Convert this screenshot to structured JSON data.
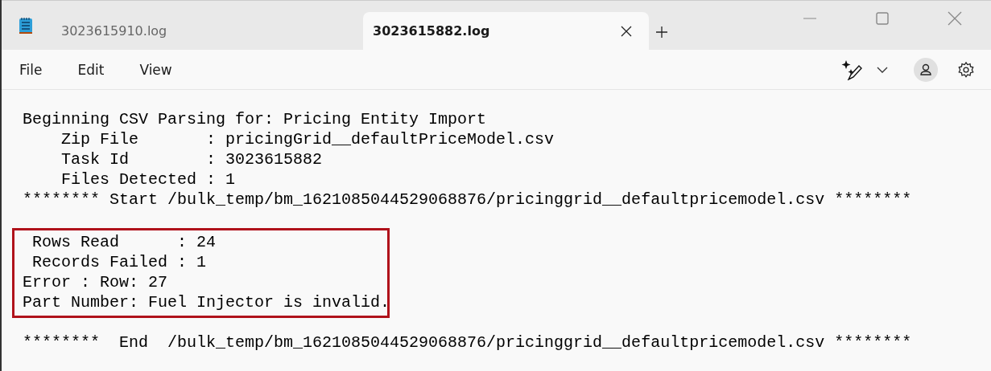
{
  "tabs": [
    {
      "label": "3023615910.log",
      "selected": false
    },
    {
      "label": "3023615882.log",
      "selected": true
    }
  ],
  "menu": [
    "File",
    "Edit",
    "View"
  ],
  "document": {
    "lines_before": [
      "Beginning CSV Parsing for: Pricing Entity Import",
      "    Zip File       : pricingGrid__defaultPriceModel.csv",
      "    Task Id        : 3023615882",
      "    Files Detected : 1",
      "******** Start /bulk_temp/bm_1621085044529068876/pricinggrid__defaultpricemodel.csv ********"
    ],
    "highlighted": [
      " Rows Read      : 24",
      " Records Failed : 1",
      "Error : Row: 27",
      "Part Number: Fuel Injector is invalid."
    ],
    "lines_after": [
      "********  End  /bulk_temp/bm_1621085044529068876/pricinggrid__defaultpricemodel.csv ********"
    ]
  }
}
